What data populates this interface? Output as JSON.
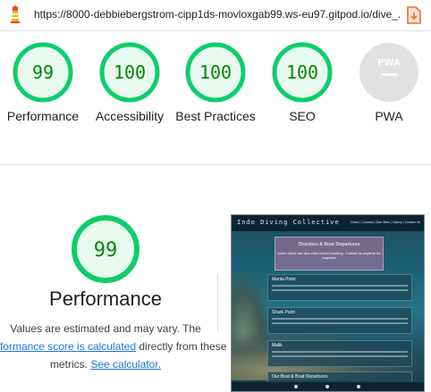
{
  "browser": {
    "url": "https://8000-debbiebergstrom-cipp1ds-movloxgab99.ws-eu97.gitpod.io/dive_..."
  },
  "categories": [
    {
      "label": "Performance",
      "score": "99",
      "value": 99,
      "kind": "score"
    },
    {
      "label": "Accessibility",
      "score": "100",
      "value": 100,
      "kind": "score"
    },
    {
      "label": "Best Practices",
      "score": "100",
      "value": 100,
      "kind": "score"
    },
    {
      "label": "SEO",
      "score": "100",
      "value": 100,
      "kind": "score"
    },
    {
      "label": "PWA",
      "score": "PWA",
      "kind": "pwa"
    }
  ],
  "details": {
    "score": "99",
    "value": 99,
    "title": "Performance",
    "desc_line1": "Values are estimated and may vary. The",
    "desc_link": "performance score is calculated",
    "desc_after_link": " directly from these",
    "desc_line3": "metrics. ",
    "calc_link": "See calculator."
  },
  "screenshot": {
    "brand": "Indo Diving Collective",
    "nav": "Home | Courses | Dive Sites | Gallery | Contact Us",
    "hero_title": "Divesites & Boat Departures",
    "hero_sub": "Learn about the dive sites before booking. Contact us anytime for requests",
    "panels": [
      "Manta Point",
      "Shark Point",
      "Malik",
      "Our Boat & Boat Departures"
    ]
  },
  "colors": {
    "pass": "#0cce6b",
    "pass_text": "#008800",
    "pass_fill": "#e8f9ef",
    "pwa_gray": "#e1e1e1",
    "link": "#1a73e8"
  },
  "icons": [
    "lighthouse-logo-icon",
    "download-icon",
    "pwa-badge-icon"
  ]
}
